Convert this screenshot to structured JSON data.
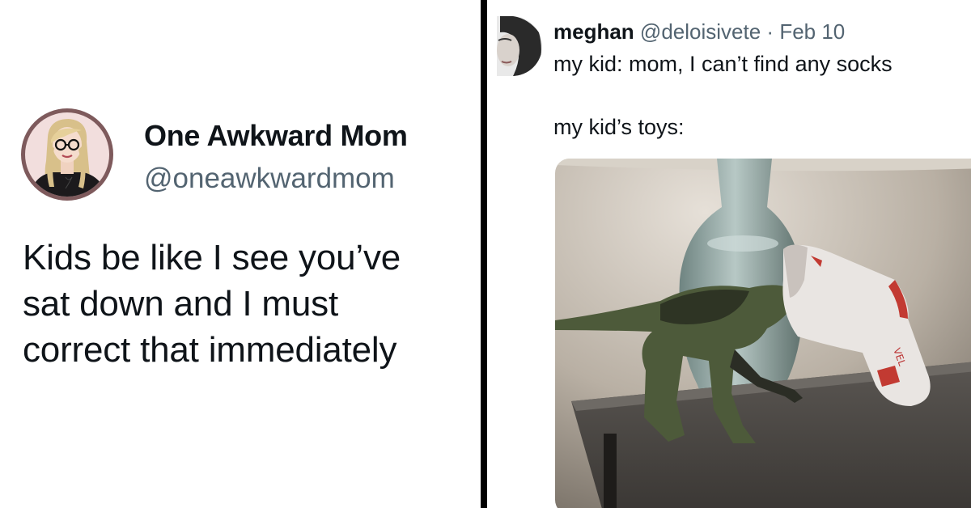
{
  "left_tweet": {
    "display_name": "One Awkward Mom",
    "handle": "@oneawkwardmom",
    "text_lines": [
      "Kids be like I see you’ve",
      "sat down and I must",
      "correct that immediately"
    ],
    "avatar_icon": "cartoon-woman-avatar-icon"
  },
  "right_tweet": {
    "display_name": "meghan",
    "handle": "@deloisivete",
    "separator": "·",
    "date": "Feb 10",
    "line1": "my kid: mom, I can’t find any socks",
    "line2": "my kid’s toys:",
    "avatar_icon": "woman-photo-avatar-icon",
    "photo_icon": "dinosaur-toy-wearing-sock-photo"
  },
  "colors": {
    "text_primary": "#0f1419",
    "text_secondary": "#536471",
    "divider": "#000000",
    "avatar_ring": "#7e5a5c"
  }
}
